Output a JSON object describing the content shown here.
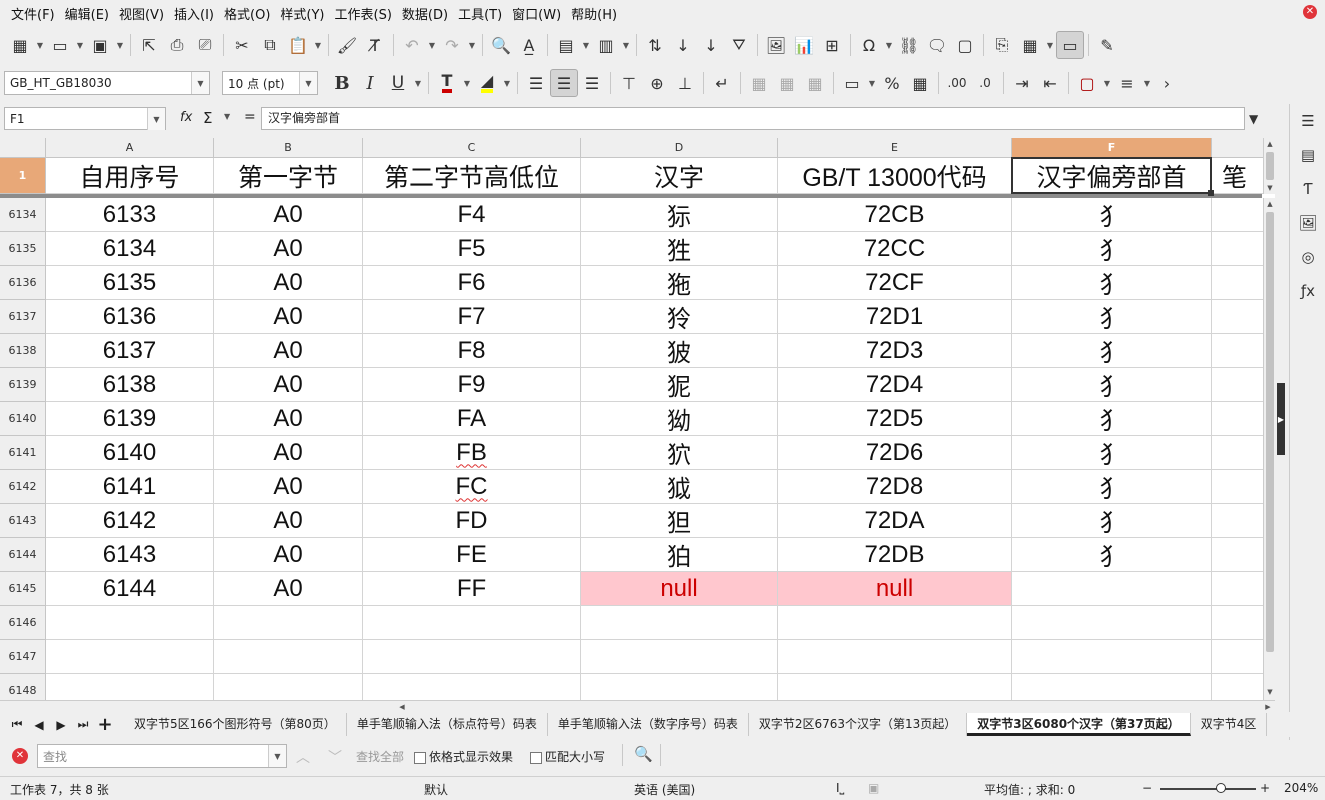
{
  "menu": [
    "文件(F)",
    "编辑(E)",
    "视图(V)",
    "插入(I)",
    "格式(O)",
    "样式(Y)",
    "工作表(S)",
    "数据(D)",
    "工具(T)",
    "窗口(W)",
    "帮助(H)"
  ],
  "format_toolbar": {
    "font_name": "GB_HT_GB18030",
    "font_size": "10 点 (pt)",
    "bold_label": "B",
    "italic_label": "I",
    "underline_label": "U",
    "font_color": "#cc0000",
    "highlight_color": "#ffff00"
  },
  "formula_bar": {
    "name_box": "F1",
    "fx": "fx",
    "sum": "Σ",
    "equals": "=",
    "content": "汉字偏旁部首"
  },
  "columns": [
    "A",
    "B",
    "C",
    "D",
    "E",
    "F"
  ],
  "selected_column": "F",
  "header_row": {
    "row_number": "1",
    "cells": [
      "自用序号",
      "第一字节",
      "第二字节高低位",
      "汉字",
      "GB/T  13000代码",
      "汉字偏旁部首",
      "笔"
    ]
  },
  "rows": [
    {
      "n": "6134",
      "cells": [
        "6133",
        "A0",
        "F4",
        "狋",
        "72CB",
        "犭"
      ]
    },
    {
      "n": "6135",
      "cells": [
        "6134",
        "A0",
        "F5",
        "狌",
        "72CC",
        "犭"
      ]
    },
    {
      "n": "6136",
      "cells": [
        "6135",
        "A0",
        "F6",
        "狏",
        "72CF",
        "犭"
      ]
    },
    {
      "n": "6137",
      "cells": [
        "6136",
        "A0",
        "F7",
        "狑",
        "72D1",
        "犭"
      ]
    },
    {
      "n": "6138",
      "cells": [
        "6137",
        "A0",
        "F8",
        "狓",
        "72D3",
        "犭"
      ]
    },
    {
      "n": "6139",
      "cells": [
        "6138",
        "A0",
        "F9",
        "狔",
        "72D4",
        "犭"
      ]
    },
    {
      "n": "6140",
      "cells": [
        "6139",
        "A0",
        "FA",
        "狕",
        "72D5",
        "犭"
      ]
    },
    {
      "n": "6141",
      "cells": [
        "6140",
        "A0",
        "FB",
        "狖",
        "72D6",
        "犭"
      ]
    },
    {
      "n": "6142",
      "cells": [
        "6141",
        "A0",
        "FC",
        "狘",
        "72D8",
        "犭"
      ]
    },
    {
      "n": "6143",
      "cells": [
        "6142",
        "A0",
        "FD",
        "狚",
        "72DA",
        "犭"
      ]
    },
    {
      "n": "6144",
      "cells": [
        "6143",
        "A0",
        "FE",
        "狛",
        "72DB",
        "犭"
      ]
    },
    {
      "n": "6145",
      "cells": [
        "6144",
        "A0",
        "FF",
        "null",
        "null",
        ""
      ]
    },
    {
      "n": "6146",
      "cells": [
        "",
        "",
        "",
        "",
        "",
        ""
      ]
    },
    {
      "n": "6147",
      "cells": [
        "",
        "",
        "",
        "",
        "",
        ""
      ]
    },
    {
      "n": "6148",
      "cells": [
        "",
        "",
        "",
        "",
        "",
        ""
      ]
    }
  ],
  "null_fill_color": "#ffc7ce",
  "sheet_tabs": [
    {
      "label": "双字节5区166个图形符号（第80页）",
      "active": false
    },
    {
      "label": "单手笔顺输入法（标点符号）码表",
      "active": false
    },
    {
      "label": "单手笔顺输入法（数字序号）码表",
      "active": false
    },
    {
      "label": "双字节2区6763个汉字（第13页起）",
      "active": false
    },
    {
      "label": "双字节3区6080个汉字（第37页起）",
      "active": true
    },
    {
      "label": "双字节4区",
      "active": false
    }
  ],
  "find_bar": {
    "placeholder": "查找",
    "find_all": "查找全部",
    "format_label": "依格式显示效果",
    "match_case_label": "匹配大小写"
  },
  "status_bar": {
    "sheet_info": "工作表 7，共 8 张",
    "page_style": "默认",
    "language": "英语 (美国)",
    "stats": "平均值: ; 求和: 0",
    "zoom": "204%",
    "zoom_minus": "−",
    "zoom_plus": "+"
  }
}
